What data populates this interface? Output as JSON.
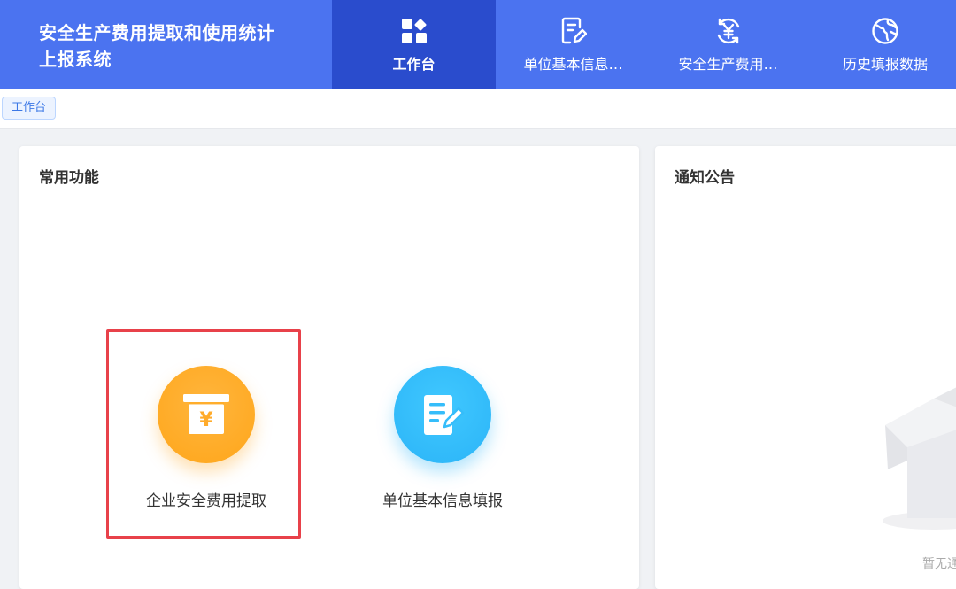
{
  "app": {
    "title_line1": "安全生产费用提取和使用统计",
    "title_line2": "上报系统"
  },
  "nav": {
    "items": [
      {
        "label": "工作台",
        "icon": "dashboard-icon",
        "active": true
      },
      {
        "label": "单位基本信息…",
        "icon": "edit-document-icon",
        "active": false
      },
      {
        "label": "安全生产费用…",
        "icon": "yuan-refresh-icon",
        "active": false
      },
      {
        "label": "历史填报数据",
        "icon": "globe-icon",
        "active": false
      }
    ]
  },
  "tags": {
    "current": "工作台"
  },
  "functions": {
    "title": "常用功能",
    "items": [
      {
        "label": "企业安全费用提取",
        "icon": "yuan-receipt-icon",
        "color": "#ffab2b"
      },
      {
        "label": "单位基本信息填报",
        "icon": "document-edit-icon",
        "color": "#35bdfa"
      }
    ]
  },
  "notice": {
    "title": "通知公告",
    "empty_text": "暂无通"
  },
  "colors": {
    "header_bg": "#4b73f0",
    "header_active": "#2a4ccd",
    "highlight_border": "#e8414a"
  }
}
